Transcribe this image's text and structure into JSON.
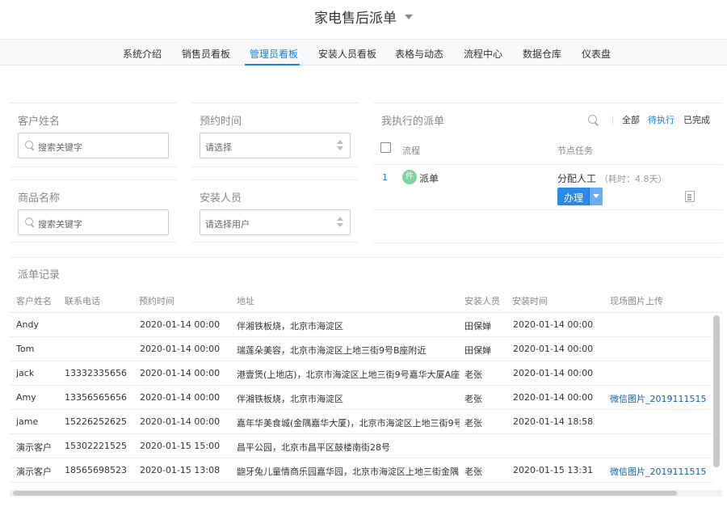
{
  "app": {
    "title": "家电售后派单"
  },
  "nav": {
    "items": [
      {
        "label": "系统介绍"
      },
      {
        "label": "销售员看板"
      },
      {
        "label": "管理员看板"
      },
      {
        "label": "安装人员看板"
      },
      {
        "label": "表格与动态"
      },
      {
        "label": "流程中心"
      },
      {
        "label": "数据仓库"
      },
      {
        "label": "仪表盘"
      }
    ],
    "active": "管理员看板"
  },
  "filters": {
    "customer_name": {
      "label": "客户姓名",
      "placeholder": "搜索关键字"
    },
    "appointment_time": {
      "label": "预约时间",
      "placeholder": "请选择"
    },
    "product_name": {
      "label": "商品名称",
      "placeholder": "搜索关键字"
    },
    "installer": {
      "label": "安装人员",
      "placeholder": "请选择用户"
    }
  },
  "tasks": {
    "title": "我执行的派单",
    "filters": [
      "全部",
      "待执行",
      "已完成"
    ],
    "active_filter": "待执行",
    "columns": [
      "流程",
      "节点任务"
    ],
    "rows": [
      {
        "no": "1",
        "badge": "件",
        "flow": "派单",
        "node": "分配人工",
        "duration": "（耗时：4.8天）",
        "action": "办理"
      }
    ]
  },
  "records": {
    "title": "派单记录",
    "columns": [
      "客户姓名",
      "联系电话",
      "预约时间",
      "地址",
      "安装人员",
      "安装时间",
      "现场图片上传"
    ],
    "rows": [
      [
        "Andy",
        "",
        "2020-01-14 00:00",
        "伴湘铁板烧，北京市海淀区",
        "田保婵",
        "2020-01-14 00:00",
        ""
      ],
      [
        "Tom",
        "",
        "2020-01-14 00:00",
        "瑞莲朵美容，北京市海淀区上地三街9号B座附近",
        "田保婵",
        "2020-01-14 00:00",
        ""
      ],
      [
        "jack",
        "13332335656",
        "2020-01-14 00:00",
        "港壹煲(上地店)，北京市海淀区上地三街9号嘉华大厦A座",
        "老张",
        "2020-01-14 00:00",
        ""
      ],
      [
        "Amy",
        "13356565656",
        "2020-01-14 00:00",
        "伴湘铁板烧，北京市海淀区",
        "老张",
        "2020-01-14 00:00",
        "微信图片_2019111515"
      ],
      [
        "jame",
        "15226252625",
        "2020-01-14 00:00",
        "嘉年华美食城(金隅嘉华大厦)，北京市海淀区上地三街9号",
        "老张",
        "2020-01-14 18:58",
        ""
      ],
      [
        "演示客户",
        "15302221525",
        "2020-01-15 15:00",
        "昌平公园，北京市昌平区鼓楼南街28号",
        "",
        "",
        ""
      ],
      [
        "演示客户",
        "18565698523",
        "2020-01-15 13:08",
        "龅牙兔儿童情商乐园嘉华园，北京市海淀区上地三街金隅",
        "老张",
        "2020-01-15 13:31",
        "微信图片_2019111515"
      ]
    ]
  },
  "colors": {
    "accent": "#1a7fd6",
    "button": "#2c89e6",
    "badge": "#7ed3a0"
  }
}
